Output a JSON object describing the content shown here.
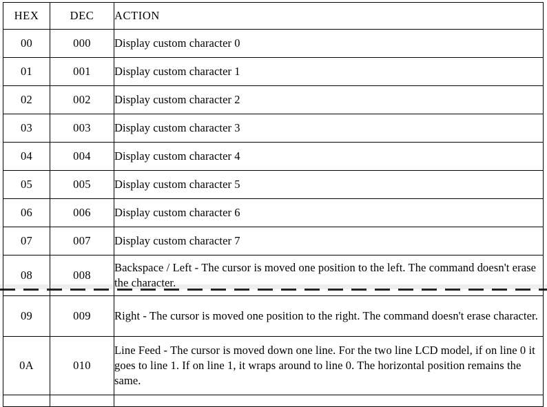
{
  "document": {
    "kind": "scanned-reference-table",
    "title": "LCD command code table"
  },
  "table": {
    "columns": [
      {
        "key": "hex",
        "label": "HEX",
        "align": "center"
      },
      {
        "key": "dec",
        "label": "DEC",
        "align": "center"
      },
      {
        "key": "action",
        "label": "ACTION",
        "align": "left"
      }
    ],
    "rows": [
      {
        "hex": "00",
        "dec": "000",
        "action": "Display custom character 0"
      },
      {
        "hex": "01",
        "dec": "001",
        "action": "Display custom character 1"
      },
      {
        "hex": "02",
        "dec": "002",
        "action": "Display custom character 2"
      },
      {
        "hex": "03",
        "dec": "003",
        "action": "Display custom character 3"
      },
      {
        "hex": "04",
        "dec": "004",
        "action": "Display custom character 4"
      },
      {
        "hex": "05",
        "dec": "005",
        "action": "Display custom character 5"
      },
      {
        "hex": "06",
        "dec": "006",
        "action": "Display custom character 6"
      },
      {
        "hex": "07",
        "dec": "007",
        "action": "Display custom character 7"
      },
      {
        "hex": "08",
        "dec": "008",
        "action": "Backspace / Left - The cursor is moved one position to the left. The command doesn't erase the character."
      },
      {
        "hex": "09",
        "dec": "009",
        "action": "Right - The cursor is moved one position to the right. The command doesn't erase character."
      },
      {
        "hex": "0A",
        "dec": "010",
        "action": "Line Feed - The cursor is moved down one line. For the two line LCD model, if on line 0 it goes to line 1. If on line 1, it wraps around to line 0. The horizontal position remains the same."
      }
    ],
    "partial_row": {
      "hex": "",
      "dec": "",
      "action": ""
    }
  },
  "colors": {
    "page_background": "#ffffff",
    "text": "#000000",
    "border": "#000000",
    "crease_artifact": "#111111"
  }
}
